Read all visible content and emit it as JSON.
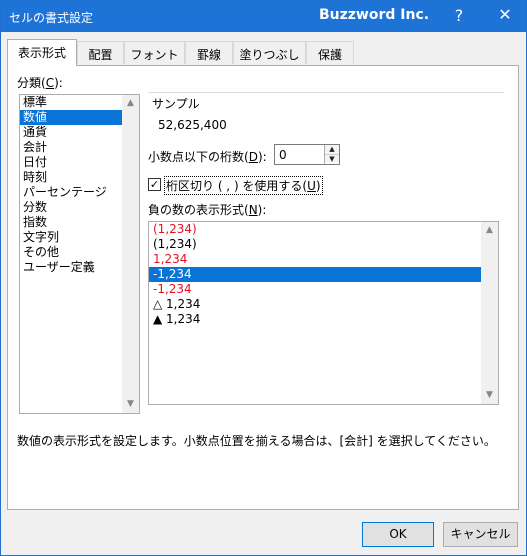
{
  "window": {
    "title": "セルの書式設定",
    "app_name": "Buzzword Inc.",
    "help": "?",
    "close": "✕"
  },
  "tabs": [
    "表示形式",
    "配置",
    "フォント",
    "罫線",
    "塗りつぶし",
    "保護"
  ],
  "category": {
    "label": "分類(",
    "accesskey": "C",
    "label_end": "):",
    "items": [
      "標準",
      "数値",
      "通貨",
      "会計",
      "日付",
      "時刻",
      "パーセンテージ",
      "分数",
      "指数",
      "文字列",
      "その他",
      "ユーザー定義"
    ],
    "selected_index": 1
  },
  "sample": {
    "label": "サンプル",
    "value": "52,625,400"
  },
  "decimal_places": {
    "label": "小数点以下の桁数(",
    "accesskey": "D",
    "label_end": "):",
    "value": "0"
  },
  "thousands_separator": {
    "label": "桁区切り ( , ) を使用する(",
    "accesskey": "U",
    "label_end": ")",
    "checked": true,
    "check_mark": "✓"
  },
  "negative_numbers": {
    "label": "負の数の表示形式(",
    "accesskey": "N",
    "label_end": "):",
    "items": [
      {
        "text": "(1,234)",
        "color": "#e81123"
      },
      {
        "text": "(1,234)",
        "color": "#000000"
      },
      {
        "text": "1,234",
        "color": "#e81123"
      },
      {
        "text": "-1,234",
        "color": "#000000"
      },
      {
        "text": "-1,234",
        "color": "#e81123"
      },
      {
        "text": "△ 1,234",
        "color": "#000000"
      },
      {
        "text": "▲ 1,234",
        "color": "#000000"
      }
    ],
    "selected_index": 3
  },
  "description": "数値の表示形式を設定します。小数点位置を揃える場合は、[会計] を選択してください。",
  "buttons": {
    "ok": "OK",
    "cancel": "キャンセル"
  },
  "colors": {
    "titlebar": "#1e73d6",
    "selection": "#0a74d6",
    "negative_red": "#e81123"
  }
}
